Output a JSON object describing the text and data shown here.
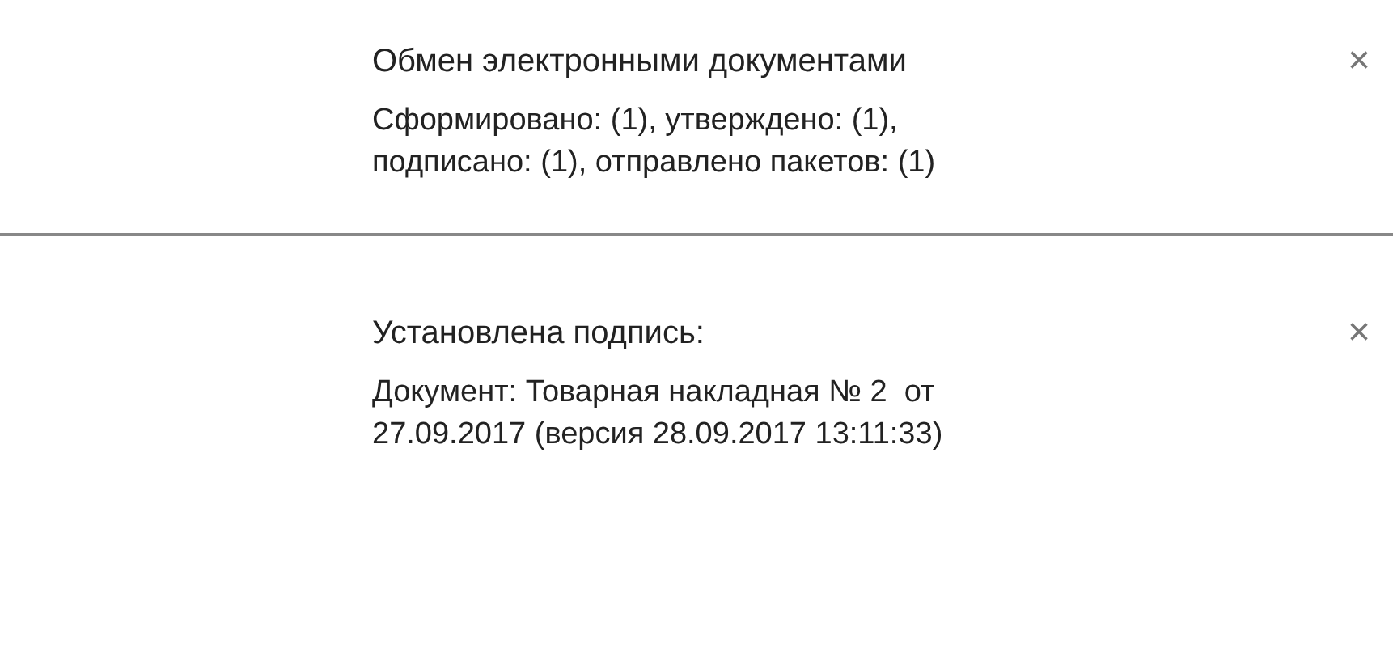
{
  "notifications": [
    {
      "title": "Обмен электронными документами",
      "lines": [
        "Сформировано: (1), утверждено: (1),",
        "подписано: (1), отправлено пакетов: (1)"
      ],
      "close": "×"
    },
    {
      "title": "Установлена подпись:",
      "lines": [
        "Документ: Товарная накладная № 2  от",
        "27.09.2017 (версия 28.09.2017 13:11:33)"
      ],
      "close": "×"
    }
  ]
}
